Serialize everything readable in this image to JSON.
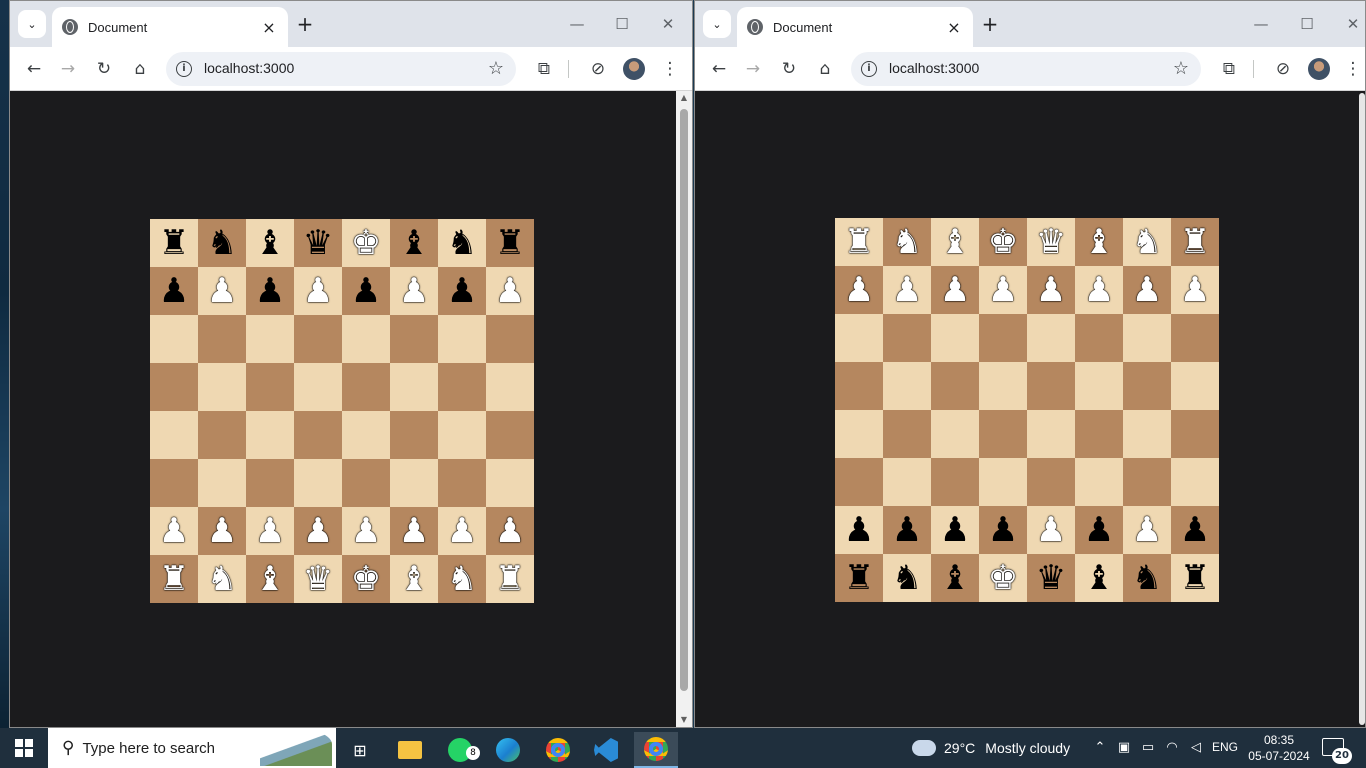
{
  "windows": [
    {
      "tab_title": "Document",
      "url": "localhost:3000",
      "controls": {
        "minimize": "—",
        "maximize": "☐",
        "close": "✕"
      },
      "board": [
        [
          "bR",
          "bN",
          "bB",
          "bQ",
          "wK",
          "bB",
          "bN",
          "bR"
        ],
        [
          "bP",
          "wP",
          "bP",
          "wP",
          "bP",
          "wP",
          "bP",
          "wP"
        ],
        [
          "",
          "",
          "",
          "",
          "",
          "",
          "",
          ""
        ],
        [
          "",
          "",
          "",
          "",
          "",
          "",
          "",
          ""
        ],
        [
          "",
          "",
          "",
          "",
          "",
          "",
          "",
          ""
        ],
        [
          "",
          "",
          "",
          "",
          "",
          "",
          "",
          ""
        ],
        [
          "wP",
          "wP",
          "wP",
          "wP",
          "wP",
          "wP",
          "wP",
          "wP"
        ],
        [
          "wR",
          "wN",
          "wB",
          "wQ",
          "wK",
          "wB",
          "wN",
          "wR"
        ]
      ]
    },
    {
      "tab_title": "Document",
      "url": "localhost:3000",
      "controls": {
        "minimize": "—",
        "maximize": "☐",
        "close": "✕"
      },
      "board": [
        [
          "wR",
          "wN",
          "wB",
          "wK",
          "wQ",
          "wB",
          "wN",
          "wR"
        ],
        [
          "wP",
          "wP",
          "wP",
          "wP",
          "wP",
          "wP",
          "wP",
          "wP"
        ],
        [
          "",
          "",
          "",
          "",
          "",
          "",
          "",
          ""
        ],
        [
          "",
          "",
          "",
          "",
          "",
          "",
          "",
          ""
        ],
        [
          "",
          "",
          "",
          "",
          "",
          "",
          "",
          ""
        ],
        [
          "",
          "",
          "",
          "",
          "",
          "",
          "",
          ""
        ],
        [
          "bP",
          "bP",
          "bP",
          "bP",
          "wP",
          "bP",
          "wP",
          "bP"
        ],
        [
          "bR",
          "bN",
          "bB",
          "wK",
          "bQ",
          "bB",
          "bN",
          "bR"
        ]
      ]
    }
  ],
  "board_colors": {
    "light": "#efd8b2",
    "dark": "#b5875f"
  },
  "piece_glyphs": {
    "K": "♚",
    "Q": "♛",
    "R": "♜",
    "B": "♝",
    "N": "♞",
    "P": "♟"
  },
  "taskbar": {
    "search_placeholder": "Type here to search",
    "whatsapp_badge": "8",
    "weather_temp": "29°C",
    "weather_text": "Mostly cloudy",
    "language": "ENG",
    "time": "08:35",
    "date": "05-07-2024",
    "notification_count": "20"
  }
}
